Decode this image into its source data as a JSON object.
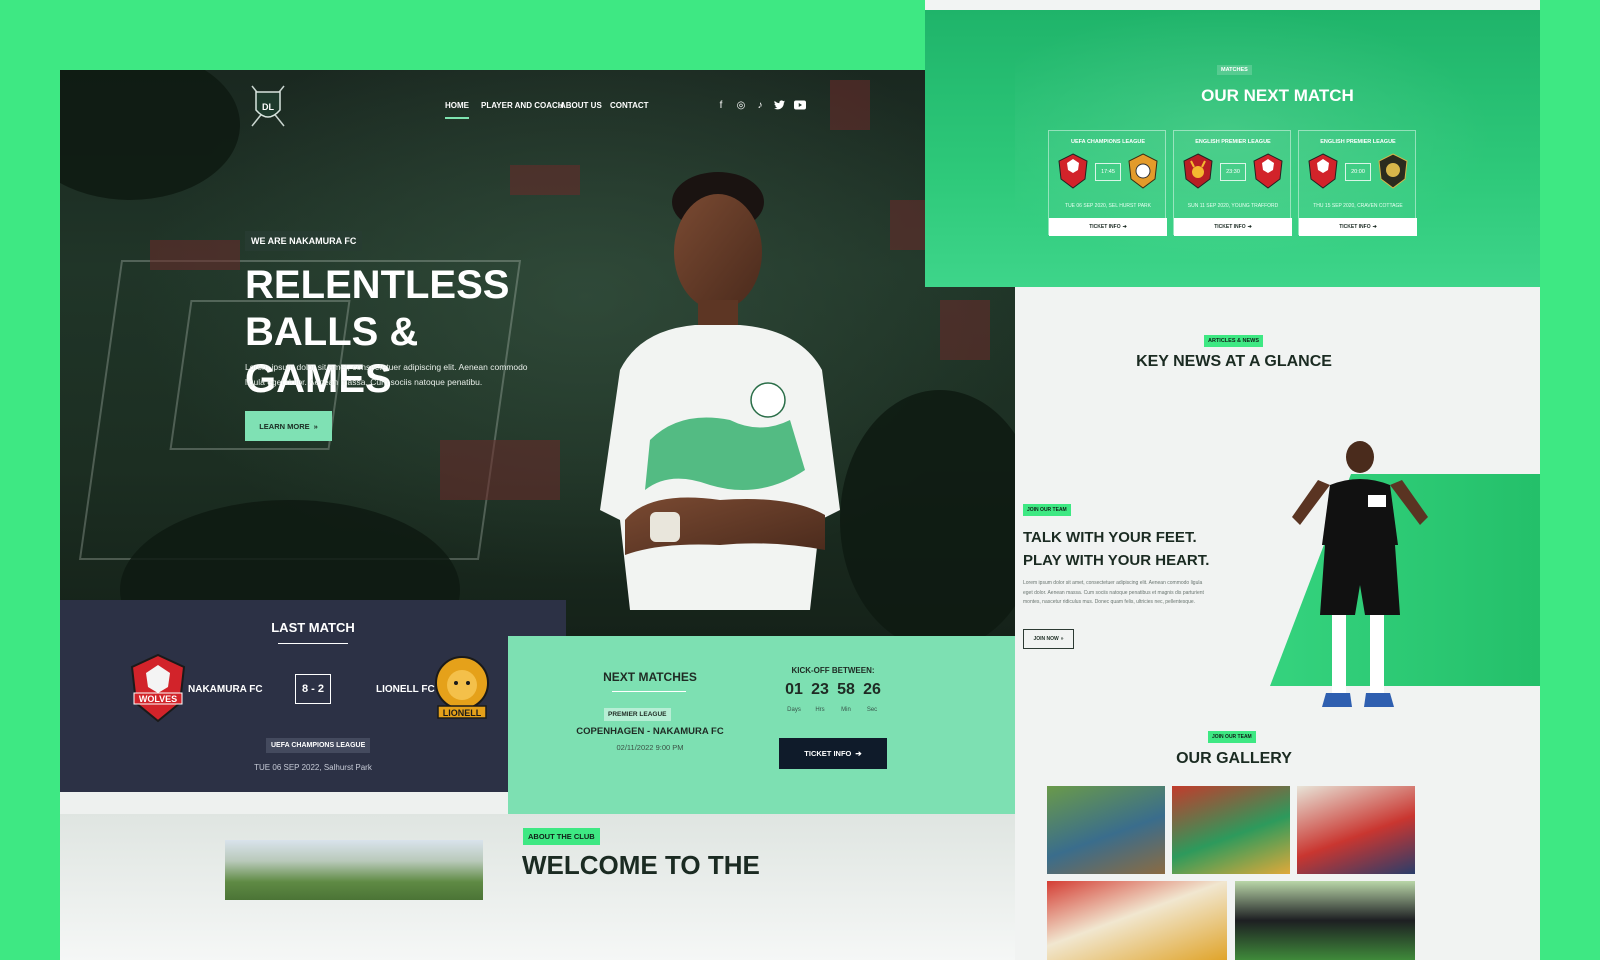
{
  "nav": {
    "items": [
      {
        "label": "HOME"
      },
      {
        "label": "PLAYER AND COACH"
      },
      {
        "label": "ABOUT US"
      },
      {
        "label": "CONTACT"
      }
    ],
    "social": [
      {
        "icon": "facebook-icon",
        "glyph": "f"
      },
      {
        "icon": "instagram-icon",
        "glyph": "◎"
      },
      {
        "icon": "tiktok-icon",
        "glyph": "♪"
      },
      {
        "icon": "twitter-icon",
        "glyph": "🐦"
      },
      {
        "icon": "youtube-icon",
        "glyph": "▶"
      }
    ]
  },
  "hero": {
    "badge": "WE ARE NAKAMURA FC",
    "title_line1": "RELENTLESS",
    "title_line2": "BALLS & GAMES",
    "text": "Lorem ipsum dolor sit amet, consectetuer adipiscing elit. Aenean commodo ligula eget dolor. Aenean massa. Cum sociis natoque penatibu.",
    "button": "LEARN MORE"
  },
  "last_match": {
    "title": "LAST MATCH",
    "home_team": "NAKAMURA FC",
    "away_team": "LIONELL FC",
    "score": "8 - 2",
    "league": "UEFA CHAMPIONS LEAGUE",
    "date": "TUE 06 SEP 2022, Salhurst Park"
  },
  "next_matches": {
    "title": "NEXT MATCHES",
    "league": "PREMIER LEAGUE",
    "fixture": "COPENHAGEN - NAKAMURA FC",
    "date": "02/11/2022 9:00 PM",
    "kickoff_label": "KICK-OFF BETWEEN:",
    "countdown": [
      {
        "value": "01",
        "label": "Days"
      },
      {
        "value": "23",
        "label": "Hrs"
      },
      {
        "value": "58",
        "label": "Min"
      },
      {
        "value": "26",
        "label": "Sec"
      }
    ],
    "ticket_button": "TICKET INFO"
  },
  "about": {
    "badge": "ABOUT THE CLUB",
    "title": "WELCOME TO THE"
  },
  "right": {
    "next_badge": "MATCHES",
    "next_title": "OUR NEXT MATCH",
    "matches": [
      {
        "league": "UEFA CHAMPIONS LEAGUE",
        "time": "17:45",
        "date": "TUE 06 SEP 2020, SEL HURST PARK",
        "button": "TICKET INFO"
      },
      {
        "league": "ENGLISH PREMIER LEAGUE",
        "time": "23:30",
        "date": "SUN 11 SEP 2020, YOUNG TRAFFORD",
        "button": "TICKET INFO"
      },
      {
        "league": "ENGLISH PREMIER LEAGUE",
        "time": "20:00",
        "date": "THU 15 SEP 2020, CRAVEN COTTAGE",
        "button": "TICKET INFO"
      }
    ],
    "news_badge": "ARTICLES & NEWS",
    "news_title": "KEY NEWS AT A GLANCE",
    "team_badge": "JOIN OUR TEAM",
    "team_title_line1": "TALK WITH YOUR FEET.",
    "team_title_line2": "PLAY WITH YOUR HEART.",
    "team_text": "Lorem ipsum dolor sit amet, consectetuer adipiscing elit. Aenean commodo ligula eget dolor. Aenean massa. Cum sociis natoque penatibus et magnis dis parturient montes, nascetur ridiculus mus. Donec quam felis, ultricies nec, pellentesque.",
    "team_button": "JOIN NOW",
    "gallery_badge": "JOIN OUR TEAM",
    "gallery_title": "OUR GALLERY"
  },
  "colors": {
    "background": "#3ee883",
    "accent_mint": "#7de0b2",
    "navy": "#2c3145",
    "dark_button": "#0f1b2a"
  }
}
